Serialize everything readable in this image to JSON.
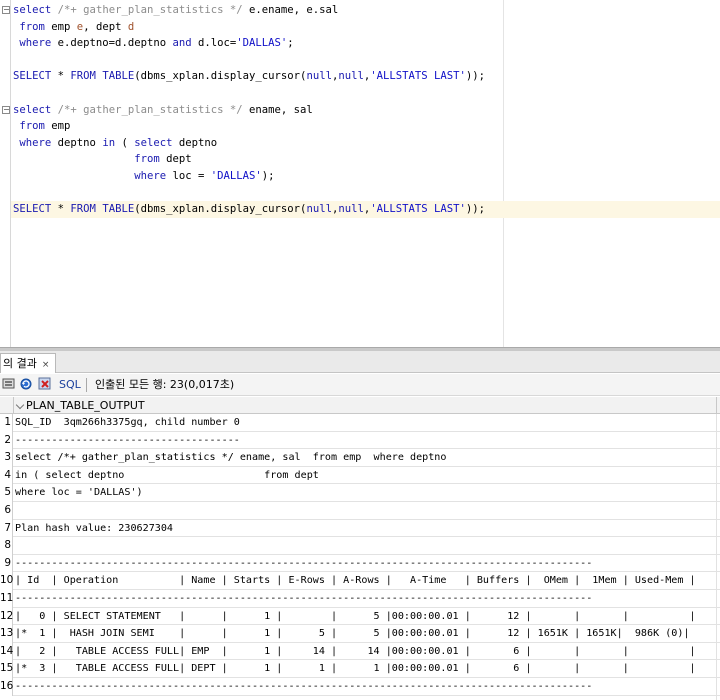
{
  "editor": {
    "lines": [
      [
        {
          "t": "select",
          "c": "kw"
        },
        {
          "t": " "
        },
        {
          "t": "/*+ gather_plan_statistics */",
          "c": "cm"
        },
        {
          "t": " e.ename, e.sal"
        }
      ],
      [
        {
          "t": " "
        },
        {
          "t": "from",
          "c": "kw"
        },
        {
          "t": " emp "
        },
        {
          "t": "e",
          "c": "id"
        },
        {
          "t": ", dept "
        },
        {
          "t": "d",
          "c": "id"
        }
      ],
      [
        {
          "t": " "
        },
        {
          "t": "where",
          "c": "kw"
        },
        {
          "t": " e.deptno=d.deptno "
        },
        {
          "t": "and",
          "c": "kw"
        },
        {
          "t": " d.loc="
        },
        {
          "t": "'DALLAS'",
          "c": "str"
        },
        {
          "t": ";"
        }
      ],
      [],
      [
        {
          "t": "SELECT",
          "c": "kw"
        },
        {
          "t": " * "
        },
        {
          "t": "FROM",
          "c": "kw"
        },
        {
          "t": " "
        },
        {
          "t": "TABLE",
          "c": "kw"
        },
        {
          "t": "(dbms_xplan.display_cursor("
        },
        {
          "t": "null",
          "c": "kw"
        },
        {
          "t": ","
        },
        {
          "t": "null",
          "c": "kw"
        },
        {
          "t": ","
        },
        {
          "t": "'ALLSTATS LAST'",
          "c": "str"
        },
        {
          "t": "));"
        }
      ],
      [],
      [
        {
          "t": "select",
          "c": "kw"
        },
        {
          "t": " "
        },
        {
          "t": "/*+ gather_plan_statistics */",
          "c": "cm"
        },
        {
          "t": " ename, sal"
        }
      ],
      [
        {
          "t": " "
        },
        {
          "t": "from",
          "c": "kw"
        },
        {
          "t": " emp"
        }
      ],
      [
        {
          "t": " "
        },
        {
          "t": "where",
          "c": "kw"
        },
        {
          "t": " deptno "
        },
        {
          "t": "in",
          "c": "kw"
        },
        {
          "t": " ( "
        },
        {
          "t": "select",
          "c": "kw"
        },
        {
          "t": " deptno"
        }
      ],
      [
        {
          "t": "                   "
        },
        {
          "t": "from",
          "c": "kw"
        },
        {
          "t": " dept"
        }
      ],
      [
        {
          "t": "                   "
        },
        {
          "t": "where",
          "c": "kw"
        },
        {
          "t": " loc = "
        },
        {
          "t": "'DALLAS'",
          "c": "str"
        },
        {
          "t": ");"
        }
      ],
      [],
      [
        {
          "t": "SELECT",
          "c": "kw"
        },
        {
          "t": " * "
        },
        {
          "t": "FROM",
          "c": "kw"
        },
        {
          "t": " "
        },
        {
          "t": "TABLE",
          "c": "kw"
        },
        {
          "t": "(dbms_xplan.display_cursor("
        },
        {
          "t": "null",
          "c": "kw"
        },
        {
          "t": ","
        },
        {
          "t": "null",
          "c": "kw"
        },
        {
          "t": ","
        },
        {
          "t": "'ALLSTATS LAST'",
          "c": "str"
        },
        {
          "t": "));"
        }
      ]
    ],
    "fold_marker": "−",
    "current_line_index": 12
  },
  "results": {
    "tab_label": "의 결과",
    "tab_close": "×",
    "toolbar": {
      "sql_label": "SQL",
      "status": "인출된 모든 행: 23(0,017초)",
      "icons": [
        "pin-icon",
        "refresh-icon",
        "cancel-icon"
      ]
    },
    "column_header": "PLAN_TABLE_OUTPUT",
    "rows": [
      {
        "n": "1",
        "text": "SQL_ID  3qm266h3375gq, child number 0"
      },
      {
        "n": "2",
        "text": "-------------------------------------"
      },
      {
        "n": "3",
        "text": "select /*+ gather_plan_statistics */ ename, sal  from emp  where deptno"
      },
      {
        "n": "4",
        "text": "in ( select deptno                       from dept"
      },
      {
        "n": "5",
        "text": "where loc = 'DALLAS')"
      },
      {
        "n": "6",
        "text": ""
      },
      {
        "n": "7",
        "text": "Plan hash value: 230627304"
      },
      {
        "n": "8",
        "text": ""
      },
      {
        "n": "9",
        "text": "-----------------------------------------------------------------------------------------------"
      },
      {
        "n": "10",
        "text": "| Id  | Operation          | Name | Starts | E-Rows | A-Rows |   A-Time   | Buffers |  OMem |  1Mem | Used-Mem |"
      },
      {
        "n": "11",
        "text": "-----------------------------------------------------------------------------------------------"
      },
      {
        "n": "12",
        "text": "|   0 | SELECT STATEMENT   |      |      1 |        |      5 |00:00:00.01 |      12 |       |       |          |"
      },
      {
        "n": "13",
        "text": "|*  1 |  HASH JOIN SEMI    |      |      1 |      5 |      5 |00:00:00.01 |      12 | 1651K | 1651K|  986K (0)|"
      },
      {
        "n": "14",
        "text": "|   2 |   TABLE ACCESS FULL| EMP  |      1 |     14 |     14 |00:00:00.01 |       6 |       |       |          |"
      },
      {
        "n": "15",
        "text": "|*  3 |   TABLE ACCESS FULL| DEPT |      1 |      1 |      1 |00:00:00.01 |       6 |       |       |          |"
      },
      {
        "n": "16",
        "text": "-----------------------------------------------------------------------------------------------"
      }
    ]
  },
  "colors": {
    "keyword": "#1a1ab0",
    "comment": "#8c8c8c",
    "string": "#1010c8",
    "current_line": "#fdf7e3"
  }
}
